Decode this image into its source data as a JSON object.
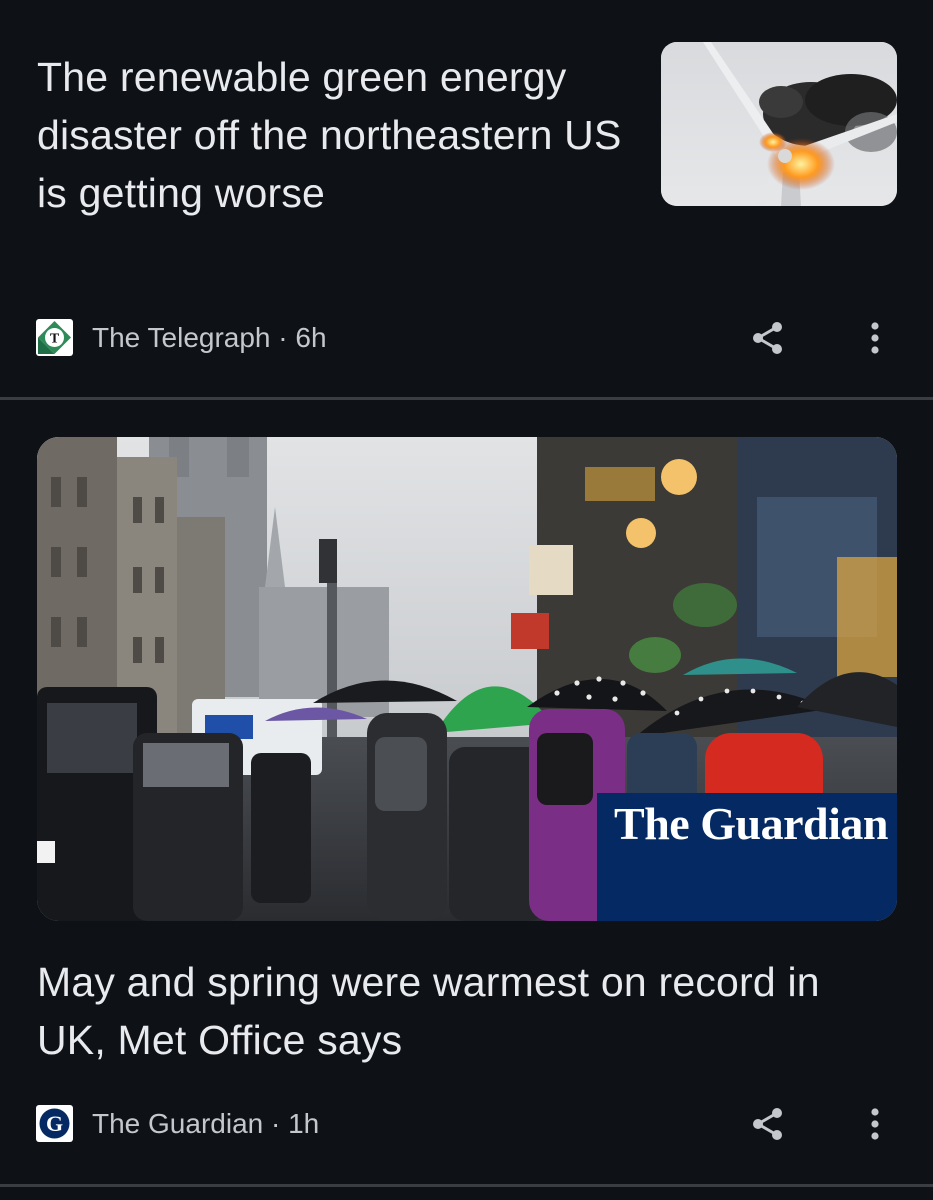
{
  "articles": [
    {
      "headline": "The renewable green energy disaster off the northeastern US is getting worse",
      "source": "The Telegraph",
      "separator": "·",
      "time": "6h",
      "source_icon": "telegraph-logo",
      "thumbnail": "burning wind turbine photo"
    },
    {
      "headline": "May and spring were warmest on record in UK, Met Office says",
      "source": "The Guardian",
      "separator": "·",
      "time": "1h",
      "source_icon": "guardian-logo",
      "image": "people with umbrellas on a rainy city street",
      "image_overlay_text": "The Guardian"
    }
  ],
  "icons": {
    "share": "share-icon",
    "more": "more-vertical-icon"
  },
  "colors": {
    "background": "#0e1217",
    "guardian_blue": "#052962",
    "telegraph_green": "#2e8b57"
  }
}
